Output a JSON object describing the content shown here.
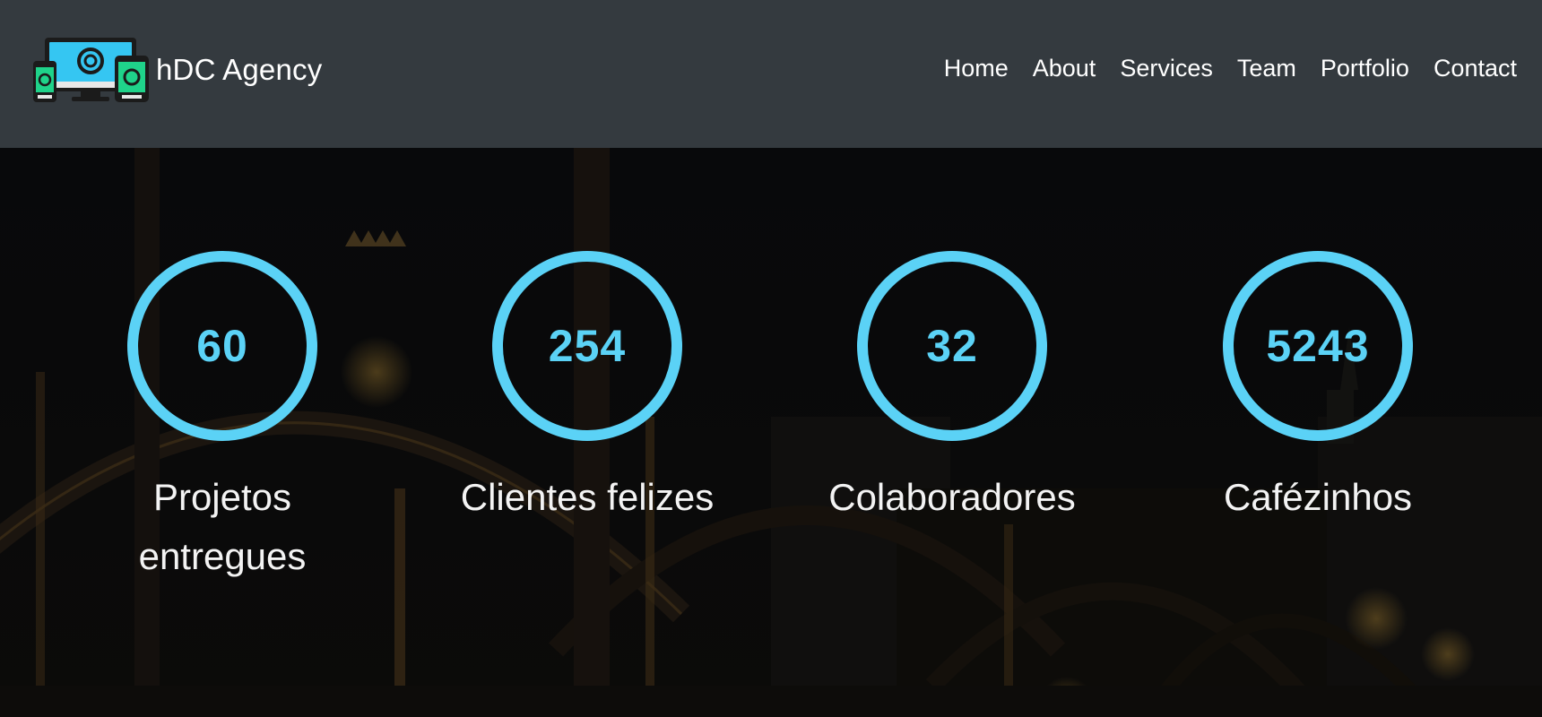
{
  "brand": {
    "name": "hDC Agency",
    "logo_icon": "devices-logo-icon"
  },
  "nav": {
    "items": [
      {
        "label": "Home"
      },
      {
        "label": "About"
      },
      {
        "label": "Services"
      },
      {
        "label": "Team"
      },
      {
        "label": "Portfolio"
      },
      {
        "label": "Contact"
      }
    ]
  },
  "hero": {
    "background_image": "night-bridge-city-photo"
  },
  "counters": [
    {
      "value": "60",
      "label": "Projetos entregues"
    },
    {
      "value": "254",
      "label": "Clientes felizes"
    },
    {
      "value": "32",
      "label": "Colaboradores"
    },
    {
      "value": "5243",
      "label": "Cafézinhos"
    }
  ],
  "colors": {
    "navbar_bg": "#343a3f",
    "accent": "#5bd2f6",
    "text": "#ffffff"
  }
}
